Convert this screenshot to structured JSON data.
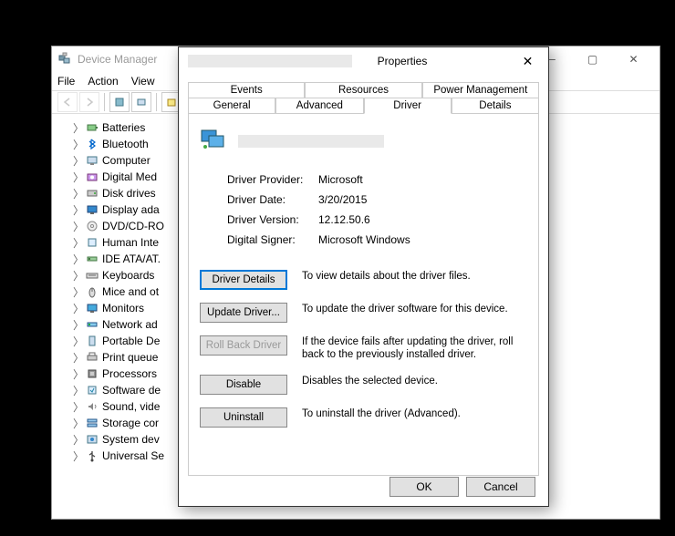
{
  "bg_window": {
    "title": "Device Manager",
    "menus": [
      "File",
      "Action",
      "View"
    ],
    "toolbar_buttons": [
      "back",
      "forward",
      "up",
      "sep",
      "properties",
      "sep",
      "refresh"
    ],
    "tree": [
      {
        "label": "Batteries",
        "icon": "battery"
      },
      {
        "label": "Bluetooth",
        "icon": "bluetooth"
      },
      {
        "label": "Computer",
        "icon": "computer"
      },
      {
        "label": "Digital Med",
        "icon": "camera"
      },
      {
        "label": "Disk drives",
        "icon": "disk"
      },
      {
        "label": "Display ada",
        "icon": "display"
      },
      {
        "label": "DVD/CD-RO",
        "icon": "dvd"
      },
      {
        "label": "Human Inte",
        "icon": "hid"
      },
      {
        "label": "IDE ATA/AT.",
        "icon": "ide"
      },
      {
        "label": "Keyboards",
        "icon": "keyboard"
      },
      {
        "label": "Mice and ot",
        "icon": "mouse"
      },
      {
        "label": "Monitors",
        "icon": "monitor"
      },
      {
        "label": "Network ad",
        "icon": "network"
      },
      {
        "label": "Portable De",
        "icon": "portable"
      },
      {
        "label": "Print queue",
        "icon": "printer"
      },
      {
        "label": "Processors",
        "icon": "cpu"
      },
      {
        "label": "Software de",
        "icon": "software"
      },
      {
        "label": "Sound, vide",
        "icon": "sound"
      },
      {
        "label": "Storage cor",
        "icon": "storage"
      },
      {
        "label": "System dev",
        "icon": "system"
      },
      {
        "label": "Universal Se",
        "icon": "usb"
      }
    ]
  },
  "dialog": {
    "title": "Properties",
    "tabs_row1": [
      "Events",
      "Resources",
      "Power Management"
    ],
    "tabs_row2": [
      "General",
      "Advanced",
      "Driver",
      "Details"
    ],
    "active_tab": "Driver",
    "info": {
      "provider_k": "Driver Provider:",
      "provider_v": "Microsoft",
      "date_k": "Driver Date:",
      "date_v": "3/20/2015",
      "version_k": "Driver Version:",
      "version_v": "12.12.50.6",
      "signer_k": "Digital Signer:",
      "signer_v": "Microsoft Windows"
    },
    "buttons": {
      "details": {
        "label": "Driver Details",
        "desc": "To view details about the driver files."
      },
      "update": {
        "label": "Update Driver...",
        "desc": "To update the driver software for this device."
      },
      "rollback": {
        "label": "Roll Back Driver",
        "desc": "If the device fails after updating the driver, roll back to the previously installed driver."
      },
      "disable": {
        "label": "Disable",
        "desc": "Disables the selected device."
      },
      "uninstall": {
        "label": "Uninstall",
        "desc": "To uninstall the driver (Advanced)."
      }
    },
    "footer": {
      "ok": "OK",
      "cancel": "Cancel"
    }
  }
}
